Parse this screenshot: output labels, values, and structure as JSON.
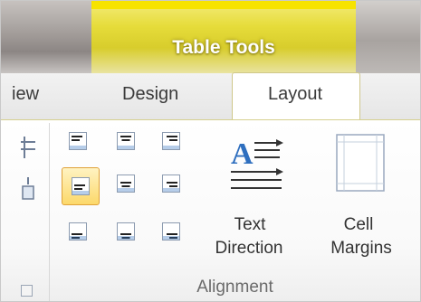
{
  "contextual": {
    "title": "Table Tools",
    "color": "#e6dc3a"
  },
  "tabs": [
    {
      "label": "iew"
    },
    {
      "label": "Design"
    },
    {
      "label": "Layout",
      "active": true
    }
  ],
  "alignment": {
    "cells": [
      {
        "name": "align-top-left",
        "selected": false
      },
      {
        "name": "align-top-center",
        "selected": false
      },
      {
        "name": "align-top-right",
        "selected": false
      },
      {
        "name": "align-center-left",
        "selected": true
      },
      {
        "name": "align-center",
        "selected": false
      },
      {
        "name": "align-center-right",
        "selected": false
      },
      {
        "name": "align-bottom-left",
        "selected": false
      },
      {
        "name": "align-bottom-center",
        "selected": false
      },
      {
        "name": "align-bottom-right",
        "selected": false
      }
    ],
    "text_direction": {
      "line1": "Text",
      "line2": "Direction",
      "icon": "text-direction-icon",
      "glyph": "A"
    },
    "cell_margins": {
      "line1": "Cell",
      "line2": "Margins",
      "icon": "cell-margins-icon"
    },
    "group_label": "Alignment"
  },
  "accent": {
    "selected_fill": "#fcd86a",
    "selected_border": "#e0a23a",
    "icon_blue": "#2f6fbf"
  }
}
